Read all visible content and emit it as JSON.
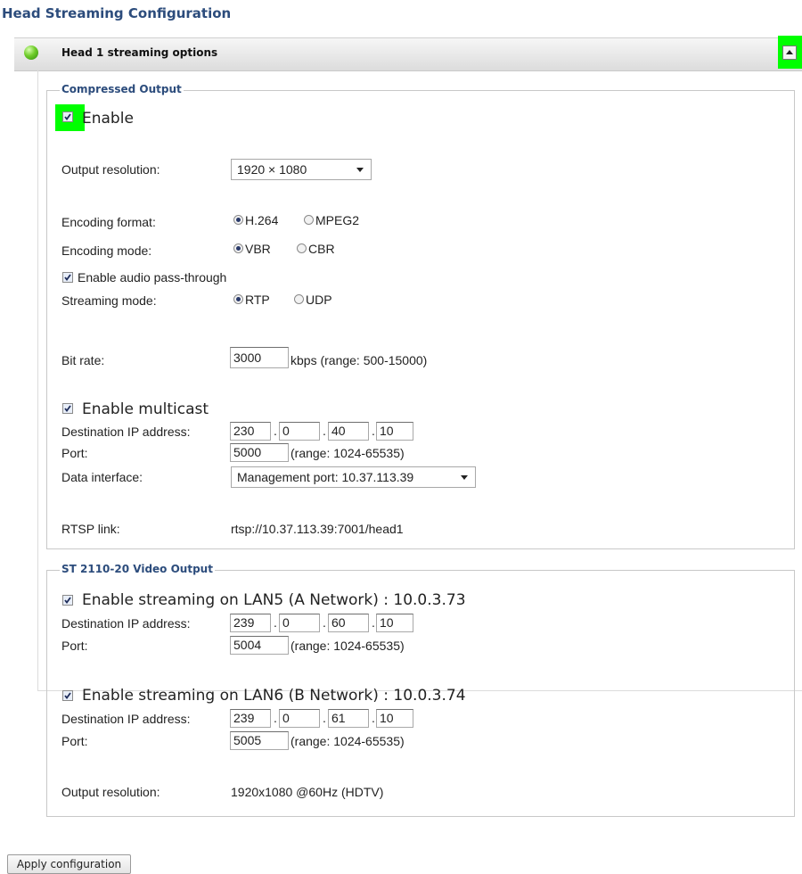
{
  "page_title": "Head Streaming Configuration",
  "panel": {
    "title": "Head 1 streaming options",
    "status_color": "#5cb82a",
    "highlight_color": "#00ff00"
  },
  "compressed_output": {
    "legend": "Compressed Output",
    "enable_label": "Enable",
    "enable_checked": true,
    "output_resolution": {
      "label": "Output resolution:",
      "value": "1920 × 1080"
    },
    "encoding_format": {
      "label": "Encoding format:",
      "options": [
        "H.264",
        "MPEG2"
      ],
      "selected": "H.264"
    },
    "encoding_mode": {
      "label": "Encoding mode:",
      "options": [
        "VBR",
        "CBR"
      ],
      "selected": "VBR"
    },
    "audio_passthrough": {
      "label": "Enable audio pass-through",
      "checked": true
    },
    "streaming_mode": {
      "label": "Streaming mode:",
      "options": [
        "RTP",
        "UDP"
      ],
      "selected": "RTP"
    },
    "bit_rate": {
      "label": "Bit rate:",
      "value": "3000",
      "hint": "kbps (range: 500-15000)"
    },
    "multicast": {
      "label": "Enable multicast",
      "checked": true
    },
    "destination_ip": {
      "label": "Destination IP address:",
      "octets": [
        "230",
        "0",
        "40",
        "10"
      ]
    },
    "port": {
      "label": "Port:",
      "value": "5000",
      "hint": "(range: 1024-65535)"
    },
    "data_interface": {
      "label": "Data interface:",
      "value": "Management port: 10.37.113.39"
    },
    "rtsp": {
      "label": "RTSP link:",
      "value": "rtsp://10.37.113.39:7001/head1"
    }
  },
  "st2110": {
    "legend": "ST 2110-20 Video Output",
    "lan5": {
      "label": "Enable streaming on LAN5 (A Network) : 10.0.3.73",
      "checked": true,
      "ip_label": "Destination IP address:",
      "octets": [
        "239",
        "0",
        "60",
        "10"
      ],
      "port_label": "Port:",
      "port": "5004",
      "port_hint": "(range: 1024-65535)"
    },
    "lan6": {
      "label": "Enable streaming on LAN6 (B Network) : 10.0.3.74",
      "checked": true,
      "ip_label": "Destination IP address:",
      "octets": [
        "239",
        "0",
        "61",
        "10"
      ],
      "port_label": "Port:",
      "port": "5005",
      "port_hint": "(range: 1024-65535)"
    },
    "output_resolution": {
      "label": "Output resolution:",
      "value": "1920x1080 @60Hz (HDTV)"
    }
  },
  "apply_button": "Apply configuration"
}
